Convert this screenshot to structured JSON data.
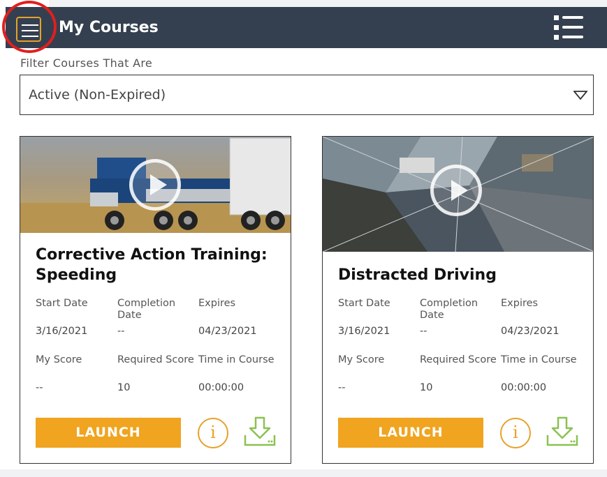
{
  "header": {
    "title": "My Courses",
    "menu_icon": "hamburger-menu-icon",
    "view_icon": "list-view-icon"
  },
  "filter": {
    "label": "Filter Courses That Are",
    "selected": "Active (Non-Expired)"
  },
  "labels": {
    "start_date": "Start Date",
    "completion_date": "Completion Date",
    "expires": "Expires",
    "my_score": "My Score",
    "required_score": "Required Score",
    "time_in_course": "Time in Course",
    "launch": "LAUNCH"
  },
  "courses": [
    {
      "title": "Corrective Action Training: Speeding",
      "start_date": "3/16/2021",
      "completion_date": "--",
      "expires": "04/23/2021",
      "my_score": "--",
      "required_score": "10",
      "time_in_course": "00:00:00"
    },
    {
      "title": "Distracted Driving",
      "start_date": "3/16/2021",
      "completion_date": "--",
      "expires": "04/23/2021",
      "my_score": "--",
      "required_score": "10",
      "time_in_course": "00:00:00"
    }
  ],
  "colors": {
    "header_bg": "#344050",
    "accent": "#f0a41f",
    "download_green": "#8cc152",
    "highlight_red": "#e01f1f"
  }
}
